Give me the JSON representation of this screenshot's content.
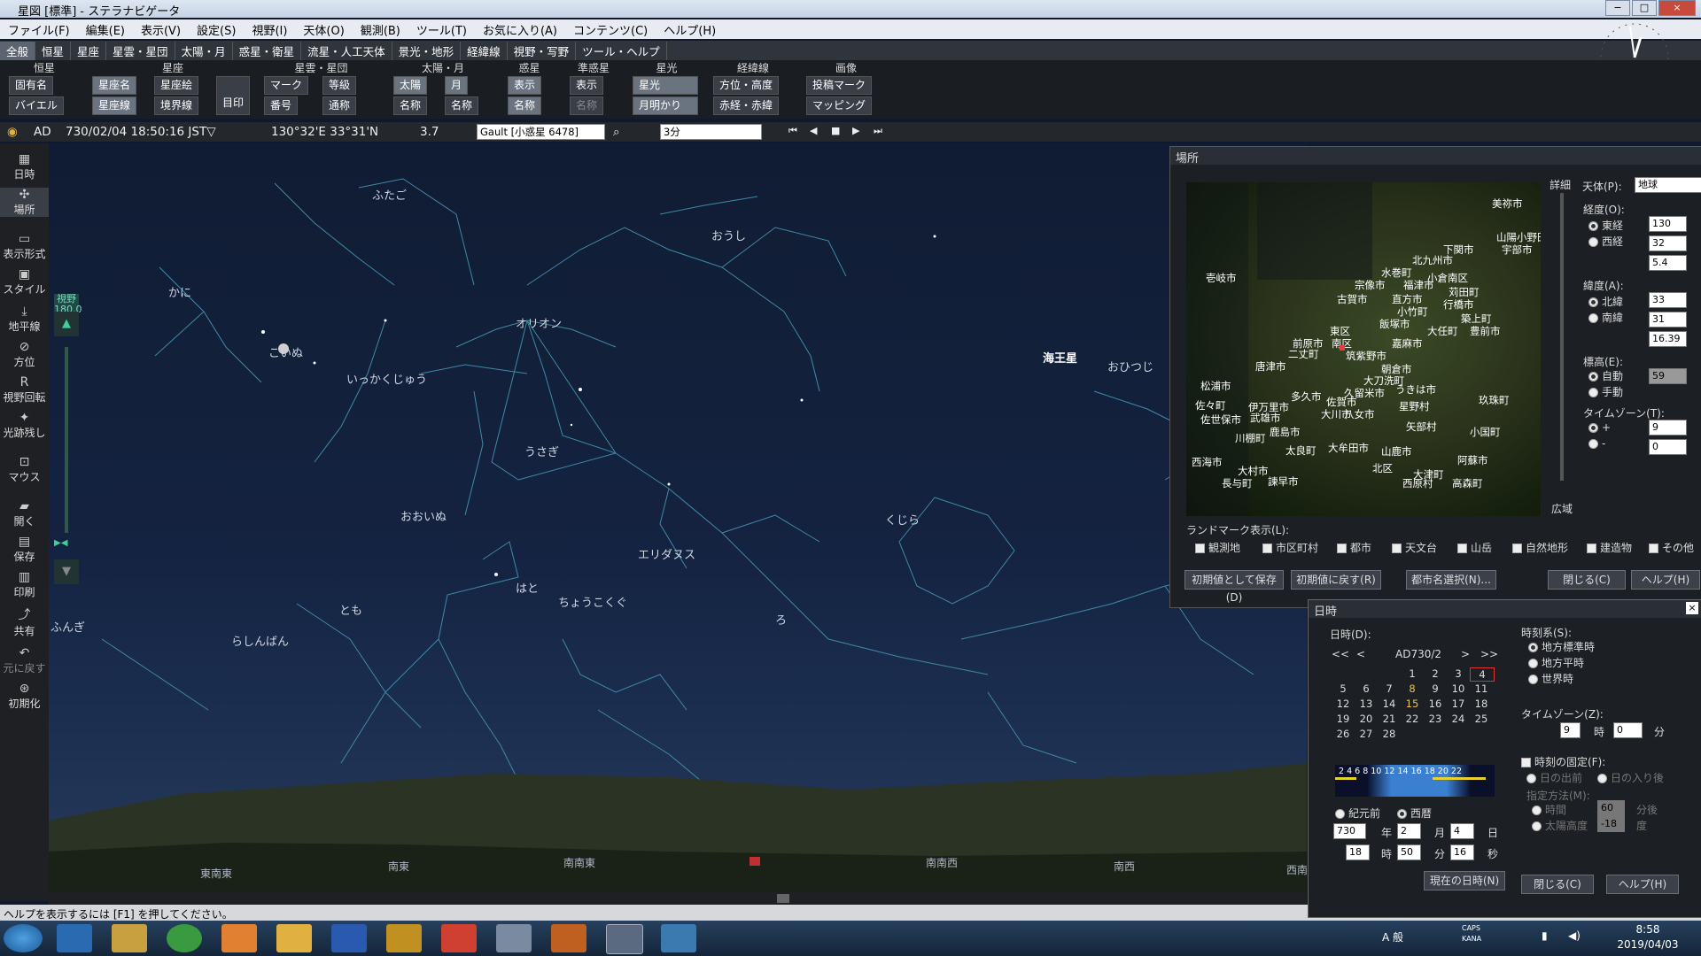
{
  "window": {
    "title": "星図 [標準] - ステラナビゲータ",
    "buttons": [
      "−",
      "□",
      "×"
    ]
  },
  "menu": [
    "ファイル(F)",
    "編集(E)",
    "表示(V)",
    "設定(S)",
    "視野(I)",
    "天体(O)",
    "観測(B)",
    "ツール(T)",
    "お気に入り(A)",
    "コンテンツ(C)",
    "ヘルプ(H)"
  ],
  "tabs": [
    "全般",
    "恒星",
    "星座",
    "星雲・星団",
    "太陽・月",
    "惑星・衛星",
    "流星・人工天体",
    "景光・地形",
    "経緯線",
    "視野・写野",
    "ツール・ヘルプ"
  ],
  "ribbon": {
    "groups": [
      "恒星",
      "星座",
      "星雲・星団",
      "太陽・月",
      "惑星",
      "準惑星",
      "星光",
      "経緯線",
      "画像"
    ],
    "buttons": {
      "koyuumei": "固有名",
      "bayer": "バイエル",
      "seizamei": "星座名",
      "seizae": "星座絵",
      "seizasen": "星座線",
      "kyoukaisen": "境界線",
      "mejirushi": "目印",
      "mark": "マーク",
      "tougyu": "等級",
      "bangou": "番号",
      "tsuushou": "通称",
      "taiyou": "太陽",
      "tsuki": "月",
      "meishou_sun": "名称",
      "meishou_moon": "名称",
      "hyouji_planet": "表示",
      "meishou_planet": "名称",
      "hyouji_dwarf": "表示",
      "meishou_dwarf": "名称",
      "seikou": "星光",
      "tsukiakari": "月明かり",
      "houi": "方位・高度",
      "sekido": "赤経・赤緯",
      "toukou": "投稿マーク",
      "mapping": "マッピング"
    }
  },
  "status": {
    "era": "AD",
    "datetime": "730/02/04 18:50:16 JST▽",
    "position": "130°32'E 33°31'N",
    "scale": "3.7",
    "catalog": "Gault [小惑星 6478]",
    "interval": "3分"
  },
  "leftbar": [
    "日時",
    "場所",
    "表示形式",
    "スタイル",
    "地平線",
    "方位",
    "視野回転",
    "光跡残し",
    "マウス",
    "開く",
    "保存",
    "印刷",
    "共有",
    "元に戻す",
    "初期化"
  ],
  "view": {
    "label": "視野",
    "value": "180.0"
  },
  "constellations": {
    "futago": "ふたご",
    "oushi": "おうし",
    "kani": "かに",
    "orion": "オリオン",
    "koinu": "こいぬ",
    "ikkakujuu": "いっかくじゅう",
    "usagi": "うさぎ",
    "ooinu": "おおいぬ",
    "eridanus": "エリダヌス",
    "kujira": "くじら",
    "hato": "はと",
    "choukokugu": "ちょうこくぐ",
    "tomo": "とも",
    "ro": "ろ",
    "rashinban": "らしんばん",
    "ohitsuji": "おひつじ",
    "kaiousei": "海王星",
    "fungi": "ふんぎ"
  },
  "directions": {
    "tounanto": "東南東",
    "nantou": "南東",
    "nannantou": "南南東",
    "minami": "南",
    "nannansei": "南南西",
    "nansei": "南西",
    "seinansei": "西南西"
  },
  "help": "ヘルプを表示するには [F1] を押してください。",
  "place_window": {
    "title": "場所",
    "detail": "詳細",
    "wide": "広域",
    "body_label": "天体(P):",
    "body_value": "地球",
    "lon_label": "経度(O):",
    "lon_east": "東経",
    "lon_west": "西経",
    "lon_deg": "130",
    "lon_min": "32",
    "lon_sec": "5.4",
    "lat_label": "緯度(A):",
    "lat_north": "北緯",
    "lat_south": "南緯",
    "lat_deg": "33",
    "lat_min": "31",
    "lat_sec": "16.39",
    "alt_label": "標高(E):",
    "alt_auto": "自動",
    "alt_manual": "手動",
    "alt_value": "59",
    "tz_label": "タイムゾーン(T):",
    "tz_plus": "+",
    "tz_minus": "-",
    "tz_hour": "9",
    "tz_min": "0",
    "landmark_label": "ランドマーク表示(L):",
    "landmarks": [
      "観測地",
      "市区町村",
      "都市",
      "天文台",
      "山岳",
      "自然地形",
      "建造物",
      "その他"
    ],
    "landmark_checked": [
      true,
      true,
      true,
      false,
      false,
      false,
      false,
      false
    ],
    "btn_save": "初期値として保存(D)",
    "btn_reset": "初期値に戻す(R)",
    "btn_city": "都市名選択(N)...",
    "btn_close": "閉じる(C)",
    "btn_help": "ヘルプ(H)",
    "cities": [
      "美祢市",
      "山陽小野田市",
      "宇部市",
      "下関市",
      "北九州市",
      "水巻町",
      "小倉南区",
      "宗像市",
      "福津市",
      "苅田町",
      "行橋市",
      "古賀市",
      "直方市",
      "小竹町",
      "飯塚市",
      "築上町",
      "豊前市",
      "大任町",
      "壱岐市",
      "東区",
      "前原市",
      "南区",
      "二丈町",
      "筑紫野市",
      "嘉麻市",
      "唐津市",
      "朝倉市",
      "大刀洗町",
      "久留米市",
      "うきは市",
      "松浦市",
      "多久市",
      "佐賀市",
      "玖珠町",
      "佐々町",
      "伊万里市",
      "武雄市",
      "大川市",
      "八女市",
      "星野村",
      "佐世保市",
      "鹿島市",
      "矢部村",
      "小国町",
      "川棚町",
      "太良町",
      "大牟田市",
      "山鹿市",
      "阿蘇市",
      "西海市",
      "大村市",
      "北区",
      "大津町",
      "長与町",
      "諫早市",
      "西原村",
      "高森町"
    ]
  },
  "date_window": {
    "title": "日時",
    "date_label": "日時(D):",
    "month_title": "AD730/2",
    "nav": [
      "<<",
      "<",
      ">",
      ">>"
    ],
    "weeks": [
      [
        "",
        "",
        "",
        "1",
        "2",
        "3",
        "4"
      ],
      [
        "5",
        "6",
        "7",
        "8",
        "9",
        "10",
        "11"
      ],
      [
        "12",
        "13",
        "14",
        "15",
        "16",
        "17",
        "18"
      ],
      [
        "19",
        "20",
        "21",
        "22",
        "23",
        "24",
        "25"
      ],
      [
        "26",
        "27",
        "28",
        "",
        "",
        "",
        ""
      ]
    ],
    "timeline": "2 4 6 8 10 12 14 16 18 20 22",
    "bc": "紀元前",
    "ad": "西暦",
    "year": "730",
    "year_unit": "年",
    "month": "2",
    "month_unit": "月",
    "day": "4",
    "day_unit": "日",
    "hour": "18",
    "hour_unit": "時",
    "minute": "50",
    "minute_unit": "分",
    "second": "16",
    "second_unit": "秒",
    "now_btn": "現在の日時(N)",
    "sys_label": "時刻系(S):",
    "sys_options": [
      "地方標準時",
      "地方平時",
      "世界時"
    ],
    "tz_label": "タイムゾーン(Z):",
    "tz_hour": "9",
    "tz_hour_unit": "時",
    "tz_min": "0",
    "tz_min_unit": "分",
    "fix_label": "時刻の固定(F):",
    "sunrise": "日の出前",
    "sunset": "日の入り後",
    "method_label": "指定方法(M):",
    "by_time": "時間",
    "time_value": "60",
    "time_unit": "分後",
    "by_sun": "太陽高度",
    "sun_value": "-18",
    "sun_unit": "度",
    "btn_close": "閉じる(C)",
    "btn_help": "ヘルプ(H)"
  },
  "taskbar": {
    "clock_time": "8:58",
    "clock_date": "2019/04/03",
    "ime": "A 般",
    "caps": "CAPS",
    "kana": "KANA"
  },
  "colors": {
    "sky_top": "#101c33",
    "sky_bottom": "#273b5c",
    "lines": "#3e8aa6",
    "horizon": "#2b3324"
  }
}
